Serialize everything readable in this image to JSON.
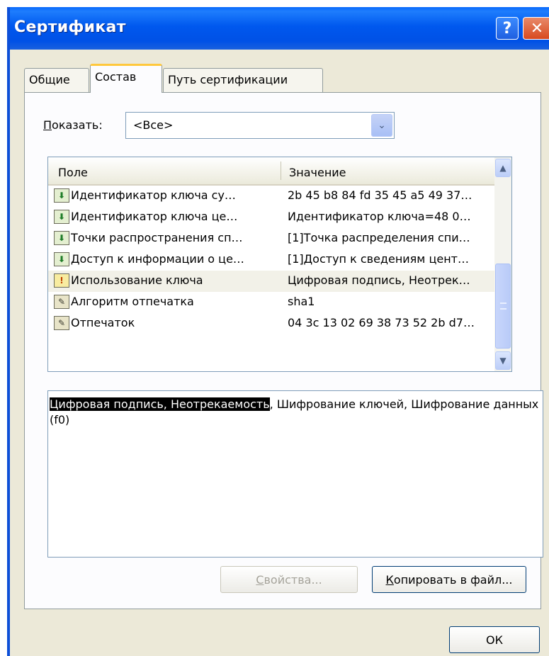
{
  "window": {
    "title": "Сертификат",
    "help_label": "?",
    "close_label": "✕"
  },
  "tabs": [
    {
      "label": "Общие",
      "active": false
    },
    {
      "label": "Состав",
      "active": true
    },
    {
      "label": "Путь сертификации",
      "active": false
    }
  ],
  "show": {
    "label_hotkey": "П",
    "label_rest": "оказать:",
    "selected": "<Все>",
    "arrow": "⌄"
  },
  "list": {
    "columns": [
      "Поле",
      "Значение"
    ],
    "rows": [
      {
        "icon": "extension-icon",
        "field": "Идентификатор ключа су…",
        "value": "2b 45 b8 84 fd 35 45 a5 49 37…",
        "selected": false
      },
      {
        "icon": "extension-icon",
        "field": "Идентификатор ключа це…",
        "value": "Идентификатор ключа=48 0…",
        "selected": false
      },
      {
        "icon": "extension-icon",
        "field": "Точки распространения сп…",
        "value": "[1]Точка распределения спи…",
        "selected": false
      },
      {
        "icon": "extension-icon",
        "field": "Доступ к информации о це…",
        "value": "[1]Доступ к сведениям цент…",
        "selected": false
      },
      {
        "icon": "critical-extension-icon",
        "field": "Использование ключа",
        "value": "Цифровая подпись, Неотрек…",
        "selected": true
      },
      {
        "icon": "property-icon",
        "field": "Алгоритм отпечатка",
        "value": "sha1",
        "selected": false
      },
      {
        "icon": "property-icon",
        "field": "Отпечаток",
        "value": "04 3c 13 02 69 38 73 52 2b d7…",
        "selected": false
      }
    ]
  },
  "detail": {
    "highlighted": "Цифровая подпись, Неотрекаемость",
    "rest": ", Шифрование ключей, Шифрование данных (f0)"
  },
  "buttons": {
    "properties_hotkey": "С",
    "properties_rest": "войства...",
    "copy_hotkey": "К",
    "copy_rest": "опировать в файл...",
    "ok": "ОК"
  }
}
